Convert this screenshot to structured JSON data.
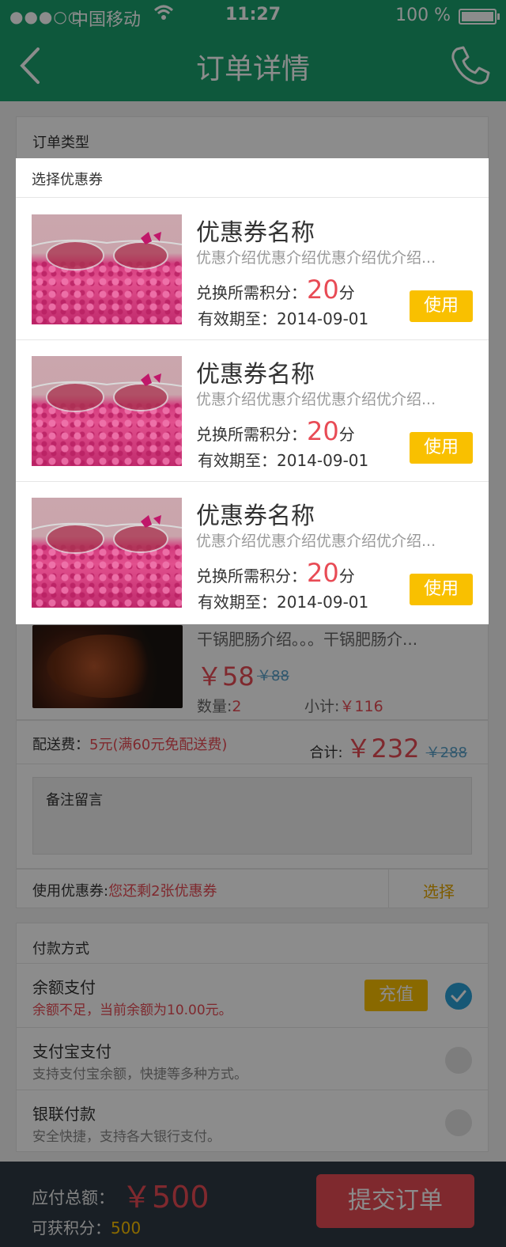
{
  "status_bar": {
    "signal": "●●●○○",
    "carrier": "中国移动",
    "time": "11:27",
    "battery": "100 %"
  },
  "nav": {
    "title": "订单详情",
    "back_icon": "chevron-left-icon",
    "phone_icon": "phone-icon"
  },
  "order": {
    "type_label": "订单类型",
    "dish": {
      "desc": "干锅肥肠介绍。。。干锅肥肠介...",
      "price": "￥58",
      "old_price": "￥88",
      "qty_label": "数量:",
      "qty": "2",
      "subtotal_label": "小计:",
      "subtotal": "￥116"
    },
    "fee_label": "配送费：",
    "fee_value": "5元(满60元免配送费)",
    "total_label": "合计:",
    "total": "￥232",
    "total_old": "￥288",
    "memo_placeholder": "备注留言",
    "coupon_label": "使用优惠券:",
    "coupon_remaining": "您还剩2张优惠券",
    "coupon_select": "选择"
  },
  "payment": {
    "title": "付款方式",
    "recharge": "充值",
    "methods": [
      {
        "name": "余额支付",
        "desc": "余额不足，当前余额为10.00元。",
        "selected": true
      },
      {
        "name": "支付宝支付",
        "desc": "支持支付宝余额，快捷等多种方式。",
        "selected": false
      },
      {
        "name": "银联付款",
        "desc": "安全快捷，支持各大银行支付。",
        "selected": false
      }
    ]
  },
  "bottom": {
    "total_label": "应付总额：",
    "total": "￥500",
    "points_label": "可获积分：",
    "points": "500",
    "submit": "提交订单"
  },
  "modal": {
    "title": "选择优惠券",
    "coupons": [
      {
        "name": "优惠券名称",
        "intro": "优惠介绍优惠介绍优惠介绍优介绍...",
        "need_label": "兑换所需积分：",
        "points": "20",
        "unit": "分",
        "expiry": "有效期至：2014-09-01",
        "use": "使用"
      },
      {
        "name": "优惠券名称",
        "intro": "优惠介绍优惠介绍优惠介绍优介绍...",
        "need_label": "兑换所需积分：",
        "points": "20",
        "unit": "分",
        "expiry": "有效期至：2014-09-01",
        "use": "使用"
      },
      {
        "name": "优惠券名称",
        "intro": "优惠介绍优惠介绍优惠介绍优介绍...",
        "need_label": "兑换所需积分：",
        "points": "20",
        "unit": "分",
        "expiry": "有效期至：2014-09-01",
        "use": "使用"
      }
    ]
  },
  "colors": {
    "brand_green": "#1aa06e",
    "accent_red": "#e84b55",
    "accent_yellow": "#f9c000",
    "select_blue": "#2aa0d8"
  }
}
